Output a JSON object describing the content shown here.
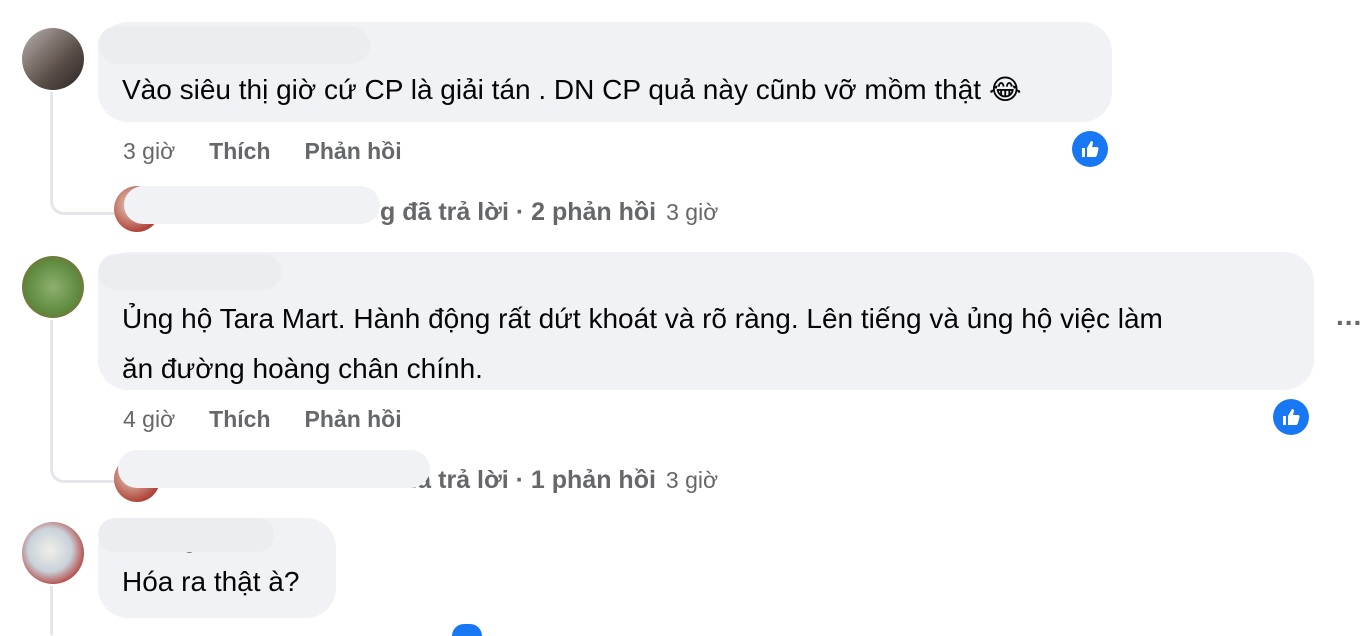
{
  "comments": [
    {
      "text": "Vào siêu thị giờ cứ CP là giải tán . DN CP quả này cũnb vỡ mồm thật",
      "emoji": "😂",
      "time": "3 giờ",
      "like": "Thích",
      "reply": "Phản hồi",
      "replies_summary": "g đã trả lời · 2 phản hồi",
      "replies_time": "3 giờ"
    },
    {
      "text_line1": "Ủng hộ Tara Mart. Hành động rất dứt khoát và rõ ràng. Lên tiếng và ủng hộ việc làm",
      "text_line2": "ăn đường hoàng chân chính.",
      "time": "4 giờ",
      "like": "Thích",
      "reply": "Phản hồi",
      "replies_summary": "đã trả lời · 1 phản hồi",
      "replies_time": "3 giờ",
      "more": "..."
    },
    {
      "author_partial": "Hương Trần",
      "text": "Hóa ra thật à?"
    }
  ],
  "colors": {
    "bubble": "#f0f2f5",
    "meta_text": "#65676b",
    "like_blue": "#1877f2",
    "thread_line": "#e4e6eb"
  },
  "icons": [
    "thumbs-up-icon",
    "laughing-emoji",
    "more-options-icon"
  ]
}
